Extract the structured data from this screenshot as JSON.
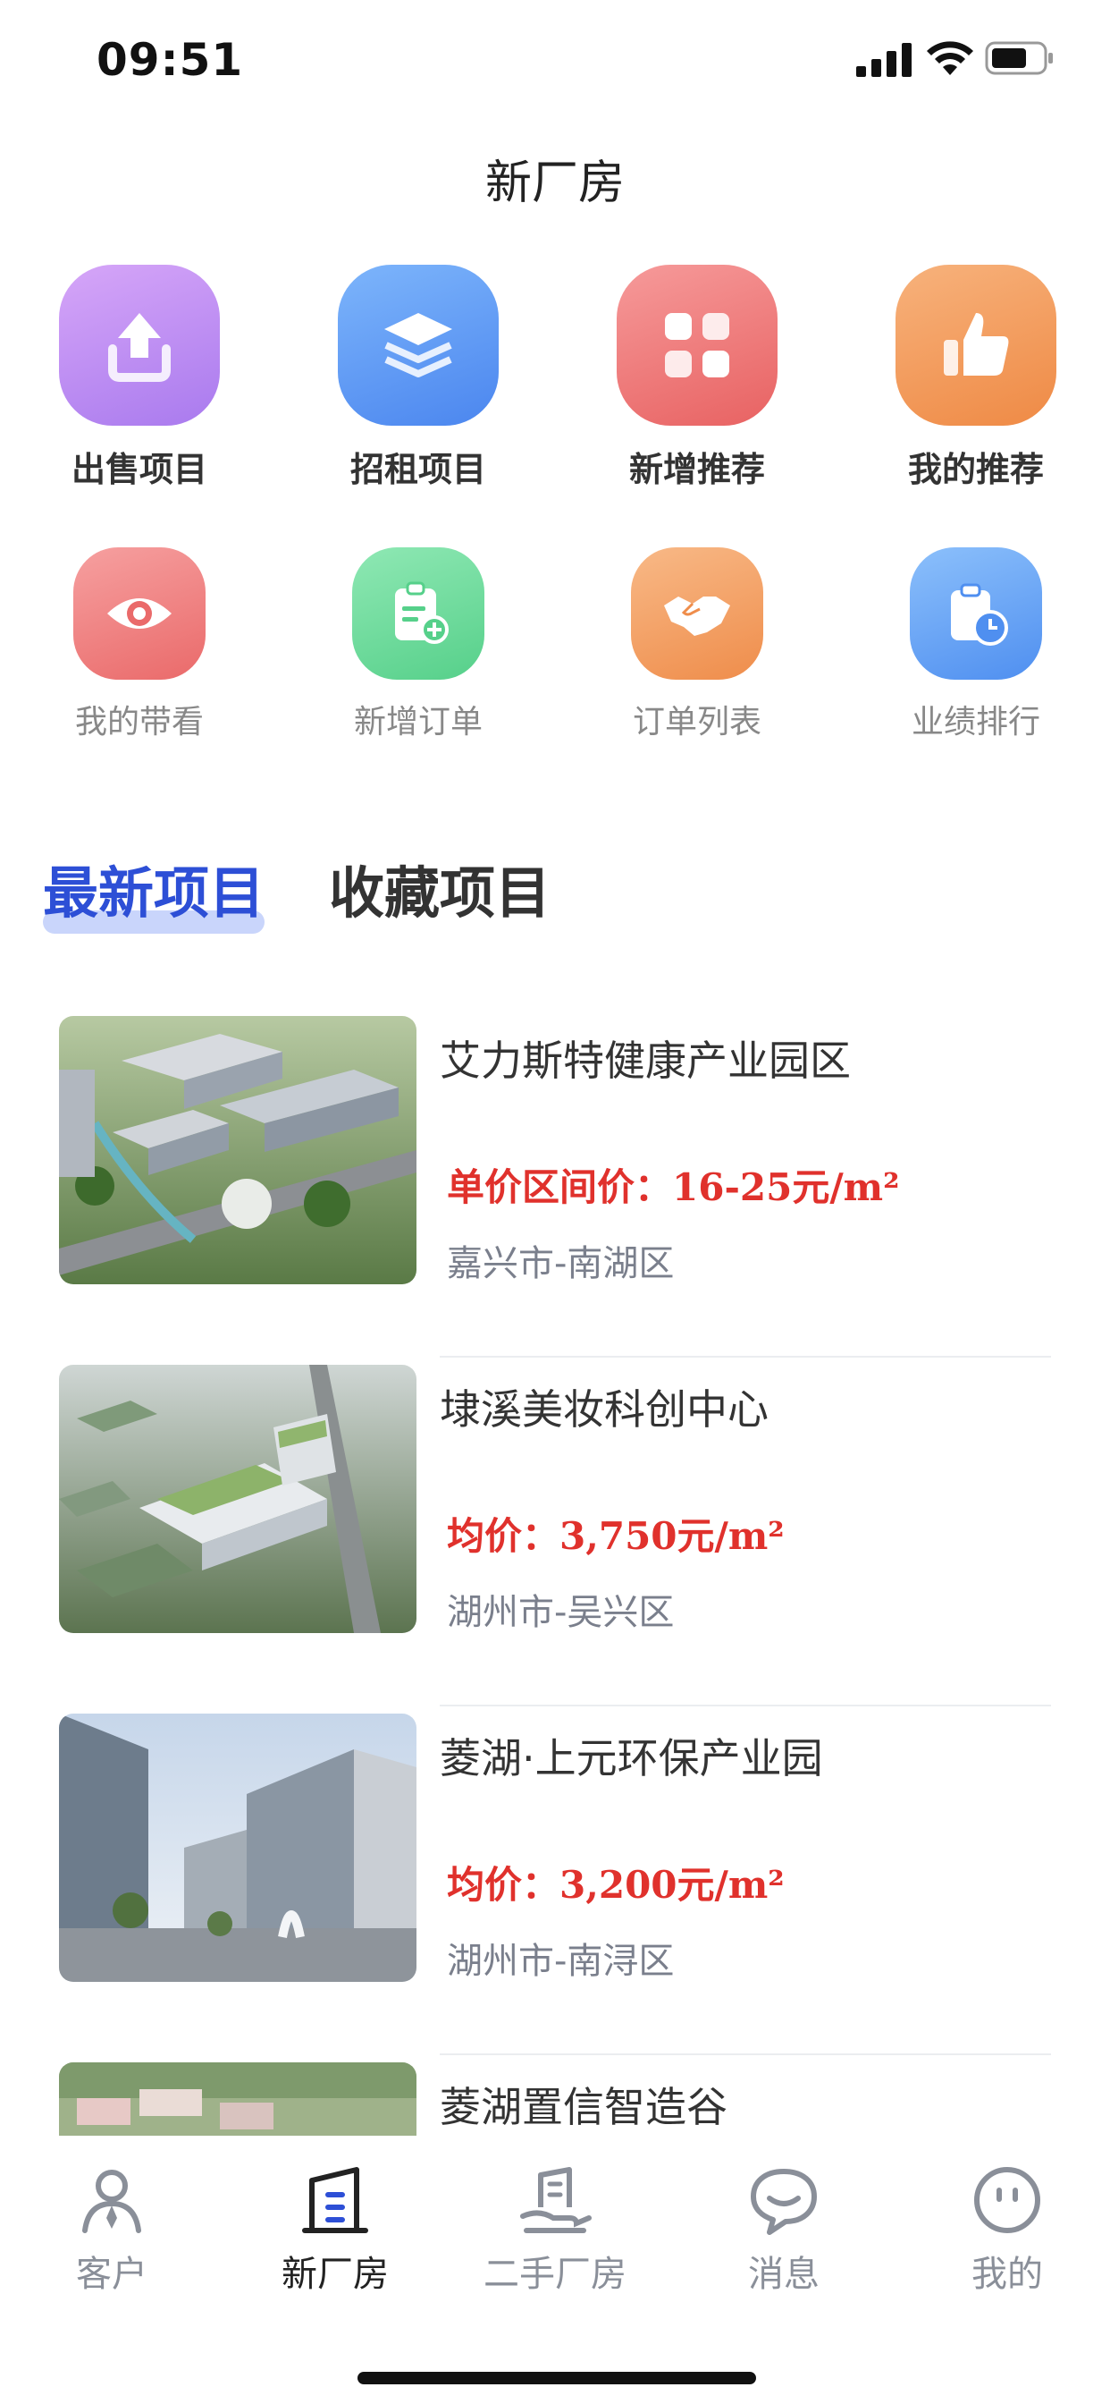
{
  "status_bar": {
    "time": "09:51"
  },
  "header": {
    "title": "新厂房"
  },
  "quick_actions": [
    {
      "label": "出售项目",
      "icon": "upload-icon",
      "color": "#b98cf2"
    },
    {
      "label": "招租项目",
      "icon": "layers-icon",
      "color": "#5f9cf5"
    },
    {
      "label": "新增推荐",
      "icon": "grid-icon",
      "color": "#f07b7b"
    },
    {
      "label": "我的推荐",
      "icon": "thumbs-up-icon",
      "color": "#f39a5a"
    }
  ],
  "secondary_actions": [
    {
      "label": "我的带看",
      "icon": "eye-icon",
      "color": "#f08080"
    },
    {
      "label": "新增订单",
      "icon": "clipboard-add-icon",
      "color": "#6fdb9a"
    },
    {
      "label": "订单列表",
      "icon": "handshake-icon",
      "color": "#f5a062"
    },
    {
      "label": "业绩排行",
      "icon": "clipboard-clock-icon",
      "color": "#6ea9f7"
    }
  ],
  "tabs": {
    "active": "最新项目",
    "second": "收藏项目"
  },
  "projects": [
    {
      "name": "艾力斯特健康产业园区",
      "price": "单价区间价：16-25元/m²",
      "location": "嘉兴市-南湖区"
    },
    {
      "name": "埭溪美妆科创中心",
      "price": "均价：3,750元/m²",
      "location": "湖州市-吴兴区"
    },
    {
      "name": "菱湖·上元环保产业园",
      "price": "均价：3,200元/m²",
      "location": "湖州市-南浔区"
    },
    {
      "name": "菱湖置信智造谷",
      "price": "",
      "location": ""
    }
  ],
  "tabbar": [
    {
      "label": "客户",
      "icon": "person-icon"
    },
    {
      "label": "新厂房",
      "icon": "building-icon"
    },
    {
      "label": "二手厂房",
      "icon": "hand-building-icon"
    },
    {
      "label": "消息",
      "icon": "chat-icon"
    },
    {
      "label": "我的",
      "icon": "smile-icon"
    }
  ],
  "colors": {
    "accent": "#2d4fd6",
    "price": "#e0312c"
  }
}
